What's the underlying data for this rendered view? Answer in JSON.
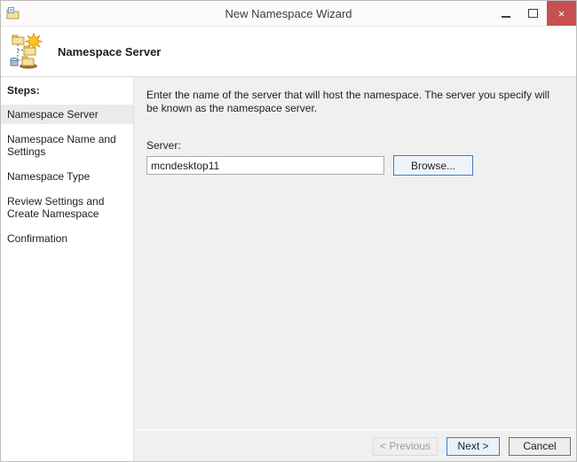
{
  "window": {
    "title": "New Namespace Wizard",
    "controls": {
      "close_glyph": "×"
    }
  },
  "header": {
    "title": "Namespace Server"
  },
  "sidebar": {
    "heading": "Steps:",
    "items": [
      {
        "label": "Namespace Server",
        "active": true
      },
      {
        "label": "Namespace Name and Settings",
        "active": false
      },
      {
        "label": "Namespace Type",
        "active": false
      },
      {
        "label": "Review Settings and Create Namespace",
        "active": false
      },
      {
        "label": "Confirmation",
        "active": false
      }
    ]
  },
  "content": {
    "instruction": "Enter the name of the server that will host the namespace. The server you specify will be known as the namespace server.",
    "server_label": "Server:",
    "server_value": "mcndesktop11",
    "browse_label": "Browse..."
  },
  "footer": {
    "previous_label": "< Previous",
    "next_label": "Next >",
    "cancel_label": "Cancel"
  },
  "colors": {
    "accent_blue_border": "#3e7fc1",
    "close_red": "#c75050",
    "content_bg": "#f0f0f0",
    "active_step_bg": "#ebebeb"
  }
}
